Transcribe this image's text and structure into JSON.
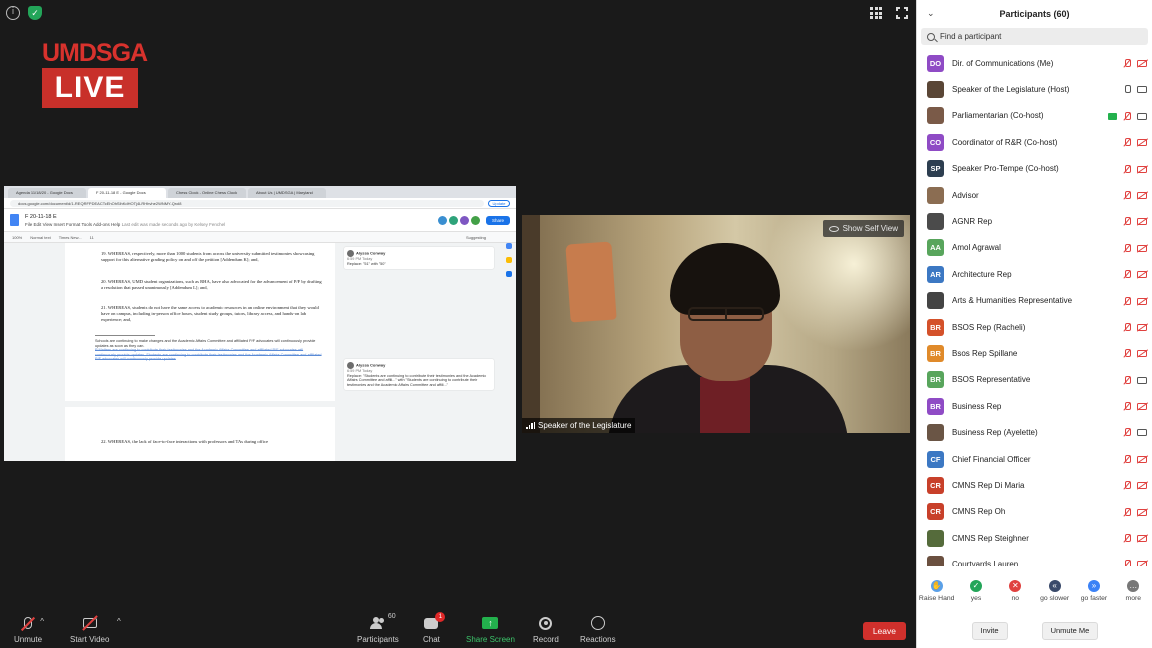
{
  "logo": {
    "top": "UMDSGA",
    "bottom": "LIVE"
  },
  "shared_screen": {
    "tabs": [
      "Agenda 11/18/20 - Google Docs",
      "F 20-11-18 E - Google Docs",
      "Chess Clock - Online Chess Clock",
      "About Us | UMDSGA | Maryland"
    ],
    "url": "docs.google.com/document/d/1-REQRFPDEACTcEhOhSlhKdHOTj4LRHhvhe2WNMY-Qrol8",
    "update_label": "Update",
    "doc_title": "F 20-11-18 E",
    "menu": [
      "File",
      "Edit",
      "View",
      "Insert",
      "Format",
      "Tools",
      "Add-ons",
      "Help",
      "Last edit was made seconds ago by Kelsey Fenchel"
    ],
    "share_label": "Share",
    "toolbar": [
      "100%",
      "Normal text",
      "Times New...",
      "11",
      "Suggesting"
    ],
    "para19": "19. WHEREAS, respectively, more than 1000 students from across the university submitted testimonies showcasing support for this alternative grading policy on and off the petition [Addendum K]; and,",
    "para20": "20. WHEREAS, UMD student organizations, such as RHA, have also advocated for the advancement of P/F by drafting a resolution that passed unanimously [Addendum L]; and,",
    "para21": "21. WHEREAS, students do not have the same access to academic resources in an online environment that they would have on campus, including in-person office hours, student study groups, tutors, library access, and hands-on lab experience; and,",
    "footnote": "Schools are continuing to make changes and the Academic Affairs Committee and affiliated P/F advocates will continuously provide updates as soon as they can.",
    "footnote_sug": "P Matters are continuing to contribute their testimonies and the Academic Affairs Committee and affiliated P/F advocates will continuously provide updates. Students are continuing to contribute their testimonies and the Academic Affairs Committee and affiliated P/F advocates will continuously provide updates",
    "para22": "22. WHEREAS, the lack of face-to-face interactions with professors and TAs during office",
    "comment1": {
      "name": "Alyssa Conway",
      "time": "6:59 PM Today",
      "text": "Replace: \"51\" with \"50\""
    },
    "comment2": {
      "name": "Alyssa Conway",
      "time": "6:59 PM Today",
      "text": "Replace: \"Students are continuing to contribute their testimonies and the Academic Affairs Committee and affili...\" with \"Students are continuing to contribute their testimonies and the Academic Affairs Committee and affili...\""
    }
  },
  "video": {
    "show_self_view": "Show Self View",
    "name": "Speaker of the Legislature"
  },
  "toolbar": {
    "unmute": "Unmute",
    "start_video": "Start Video",
    "participants": "Participants",
    "participants_count": "60",
    "chat": "Chat",
    "chat_badge": "1",
    "share_screen": "Share Screen",
    "record": "Record",
    "reactions": "Reactions",
    "leave": "Leave"
  },
  "panel": {
    "title": "Participants (60)",
    "search_placeholder": "Find a participant",
    "participants": [
      {
        "initials": "DO",
        "color": "#8f4bc5",
        "name": "Dir. of Communications (Me)",
        "mic": "muted",
        "cam": "off"
      },
      {
        "initials": "",
        "color": "#5a4636",
        "name": "Speaker of the Legislature (Host)",
        "mic": "on",
        "cam": "on"
      },
      {
        "initials": "",
        "color": "#7a5a48",
        "name": "Parliamentarian  (Co-host)",
        "mic": "muted",
        "cam": "on",
        "share": true
      },
      {
        "initials": "CO",
        "color": "#8f4bc5",
        "name": "Coordinator of R&R (Co-host)",
        "mic": "muted",
        "cam": "off"
      },
      {
        "initials": "SP",
        "color": "#2d3e50",
        "name": "Speaker Pro-Tempe (Co-host)",
        "mic": "muted",
        "cam": "off"
      },
      {
        "initials": "",
        "color": "#8b6d52",
        "name": "Advisor",
        "mic": "muted",
        "cam": "off"
      },
      {
        "initials": "",
        "color": "#4b4b4b",
        "name": "AGNR Rep",
        "mic": "muted",
        "cam": "off"
      },
      {
        "initials": "AA",
        "color": "#58a55c",
        "name": "Amol Agrawal",
        "mic": "muted",
        "cam": "off"
      },
      {
        "initials": "AR",
        "color": "#3c78c3",
        "name": "Architecture Rep",
        "mic": "muted",
        "cam": "off"
      },
      {
        "initials": "",
        "color": "#444444",
        "name": "Arts & Humanities Representative",
        "mic": "muted",
        "cam": "off"
      },
      {
        "initials": "BR",
        "color": "#d4512a",
        "name": "BSOS Rep (Racheli)",
        "mic": "muted",
        "cam": "off"
      },
      {
        "initials": "BR",
        "color": "#e08a2a",
        "name": "Bsos Rep Spillane",
        "mic": "muted",
        "cam": "off"
      },
      {
        "initials": "BR",
        "color": "#58a55c",
        "name": "BSOS Representative",
        "mic": "muted",
        "cam": "on"
      },
      {
        "initials": "BR",
        "color": "#8f4bc5",
        "name": "Business Rep",
        "mic": "muted",
        "cam": "off"
      },
      {
        "initials": "",
        "color": "#6a5545",
        "name": "Business Rep (Ayelette)",
        "mic": "muted",
        "cam": "on"
      },
      {
        "initials": "CF",
        "color": "#3c78c3",
        "name": "Chief Financial Officer",
        "mic": "muted",
        "cam": "off"
      },
      {
        "initials": "CR",
        "color": "#c8402a",
        "name": "CMNS Rep Di Maria",
        "mic": "muted",
        "cam": "off"
      },
      {
        "initials": "CR",
        "color": "#c8402a",
        "name": "CMNS Rep Oh",
        "mic": "muted",
        "cam": "off"
      },
      {
        "initials": "",
        "color": "#556b3b",
        "name": "CMNS Rep Steighner",
        "mic": "muted",
        "cam": "off"
      },
      {
        "initials": "",
        "color": "#6b5040",
        "name": "Courtyards Lauren",
        "mic": "muted",
        "cam": "off"
      }
    ],
    "reactions": [
      {
        "label": "Raise Hand",
        "color": "#5aa0e8",
        "glyph": "✋"
      },
      {
        "label": "yes",
        "color": "#23a559",
        "glyph": "✓"
      },
      {
        "label": "no",
        "color": "#e0413f",
        "glyph": "✕"
      },
      {
        "label": "go slower",
        "color": "#3a4a6a",
        "glyph": "«"
      },
      {
        "label": "go faster",
        "color": "#3b82f6",
        "glyph": "»"
      },
      {
        "label": "more",
        "color": "#777777",
        "glyph": "…"
      }
    ],
    "invite": "Invite",
    "unmute_me": "Unmute Me"
  }
}
